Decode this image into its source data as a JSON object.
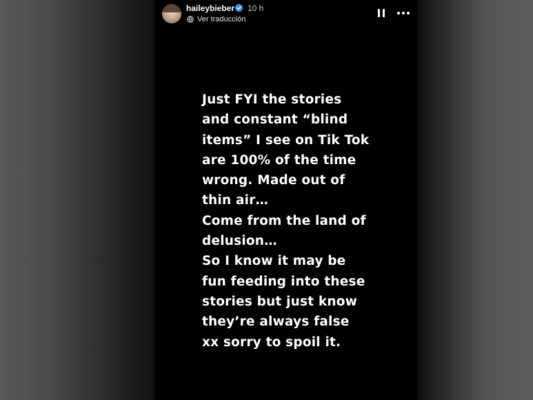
{
  "story": {
    "username": "haileybieber",
    "time": "10 h",
    "translate_label": "Ver traducción",
    "icons": {
      "verified": "verified-badge-icon",
      "translate": "translate-icon",
      "pause": "pause-icon",
      "more": "more-options-icon"
    },
    "colors": {
      "verified": "#3897f0",
      "background": "#000000",
      "text": "#ffffff"
    },
    "lines": [
      "Just FYI the stories",
      "and constant “blind",
      "items” I see on Tik Tok",
      "are 100% of the time",
      "wrong. Made out of",
      "thin air…",
      "Come from the land of",
      "delusion…",
      "So I know it may be",
      "fun feeding into these",
      "stories but just know",
      "they’re always false",
      "xx sorry to spoil it."
    ]
  }
}
